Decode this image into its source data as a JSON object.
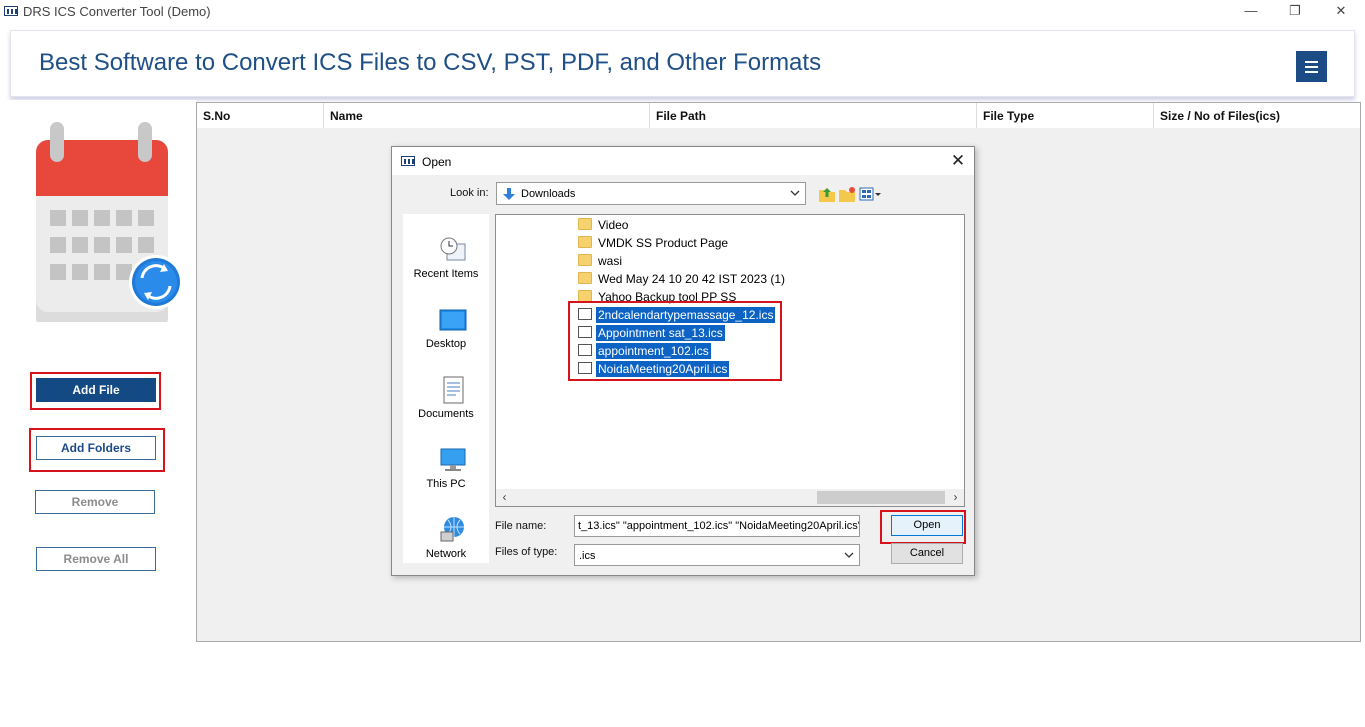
{
  "window": {
    "title": "DRS ICS Converter Tool (Demo)",
    "minimize": "—",
    "restore": "❐",
    "close": "✕"
  },
  "header": {
    "title": "Best Software to Convert ICS Files to CSV, PST, PDF, and Other Formats",
    "menu_icon": "hamburger-icon"
  },
  "sidebar": {
    "add_file": "Add File",
    "add_folders": "Add Folders",
    "remove": "Remove",
    "remove_all": "Remove All"
  },
  "grid": {
    "columns": [
      "S.No",
      "Name",
      "File Path",
      "File Type",
      "Size / No of Files(ics)"
    ]
  },
  "dialog": {
    "title": "Open",
    "close": "✕",
    "look_in_label": "Look in:",
    "look_in_value": "Downloads",
    "places": [
      {
        "label": "Recent Items",
        "icon": "recent-items-icon"
      },
      {
        "label": "Desktop",
        "icon": "desktop-icon"
      },
      {
        "label": "Documents",
        "icon": "documents-icon"
      },
      {
        "label": "This PC",
        "icon": "this-pc-icon"
      },
      {
        "label": "Network",
        "icon": "network-icon"
      }
    ],
    "files": [
      {
        "name": "Video",
        "type": "folder",
        "selected": false
      },
      {
        "name": "VMDK SS Product Page",
        "type": "folder",
        "selected": false
      },
      {
        "name": "wasi",
        "type": "folder",
        "selected": false
      },
      {
        "name": "Wed May 24 10 20 42 IST 2023 (1)",
        "type": "folder",
        "selected": false
      },
      {
        "name": "Yahoo Backup tool PP SS",
        "type": "folder",
        "selected": false
      },
      {
        "name": "2ndcalendartypemassage_12.ics",
        "type": "file",
        "selected": true
      },
      {
        "name": "Appointment sat_13.ics",
        "type": "file",
        "selected": true
      },
      {
        "name": "appointment_102.ics",
        "type": "file",
        "selected": true
      },
      {
        "name": "NoidaMeeting20April.ics",
        "type": "file",
        "selected": true
      }
    ],
    "file_name_label": "File name:",
    "file_name_value": "t_13.ics\" \"appointment_102.ics\" \"NoidaMeeting20April.ics\"",
    "files_of_type_label": "Files of type:",
    "files_of_type_value": ".ics",
    "open_button": "Open",
    "cancel_button": "Cancel"
  },
  "colors": {
    "accent": "#1c4b86",
    "highlight_box": "#d8121b",
    "selection": "#0c63c4"
  }
}
